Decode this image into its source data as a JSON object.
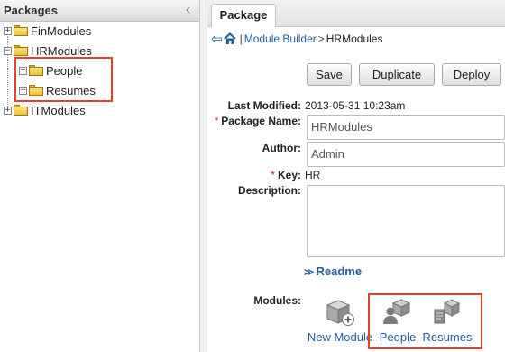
{
  "left_panel": {
    "title": "Packages",
    "tree": [
      {
        "label": "FinModules",
        "toggle": "+"
      },
      {
        "label": "HRModules",
        "toggle": "−",
        "children": [
          {
            "label": "People",
            "toggle": "+"
          },
          {
            "label": "Resumes",
            "toggle": "+"
          }
        ]
      },
      {
        "label": "ITModules",
        "toggle": "+"
      }
    ]
  },
  "right_panel": {
    "tab_label": "Package",
    "breadcrumb": {
      "link": "Module Builder",
      "separator": "|",
      "arrow": ">",
      "current": "HRModules"
    },
    "buttons": {
      "save": "Save",
      "duplicate": "Duplicate",
      "deploy": "Deploy"
    },
    "fields": {
      "last_modified": {
        "label": "Last Modified:",
        "value": "2013-05-31 10:23am"
      },
      "package_name": {
        "label": "Package Name:",
        "value": "HRModules",
        "required": "*"
      },
      "author": {
        "label": "Author:",
        "value": "Admin"
      },
      "key": {
        "label": "Key:",
        "value": "HR",
        "required": "*"
      },
      "description": {
        "label": "Description:",
        "value": ""
      }
    },
    "readme": {
      "chevron": "≫",
      "label": "Readme"
    },
    "modules": {
      "label": "Modules:",
      "items": [
        {
          "label": "New Module",
          "icon": "new-module-icon"
        },
        {
          "label": "People",
          "icon": "module-people-icon"
        },
        {
          "label": "Resumes",
          "icon": "module-resumes-icon"
        }
      ]
    }
  },
  "colors": {
    "link": "#1f5f9e",
    "highlight": "#e8402a",
    "required": "#d02020",
    "folder": "#eec23c"
  }
}
